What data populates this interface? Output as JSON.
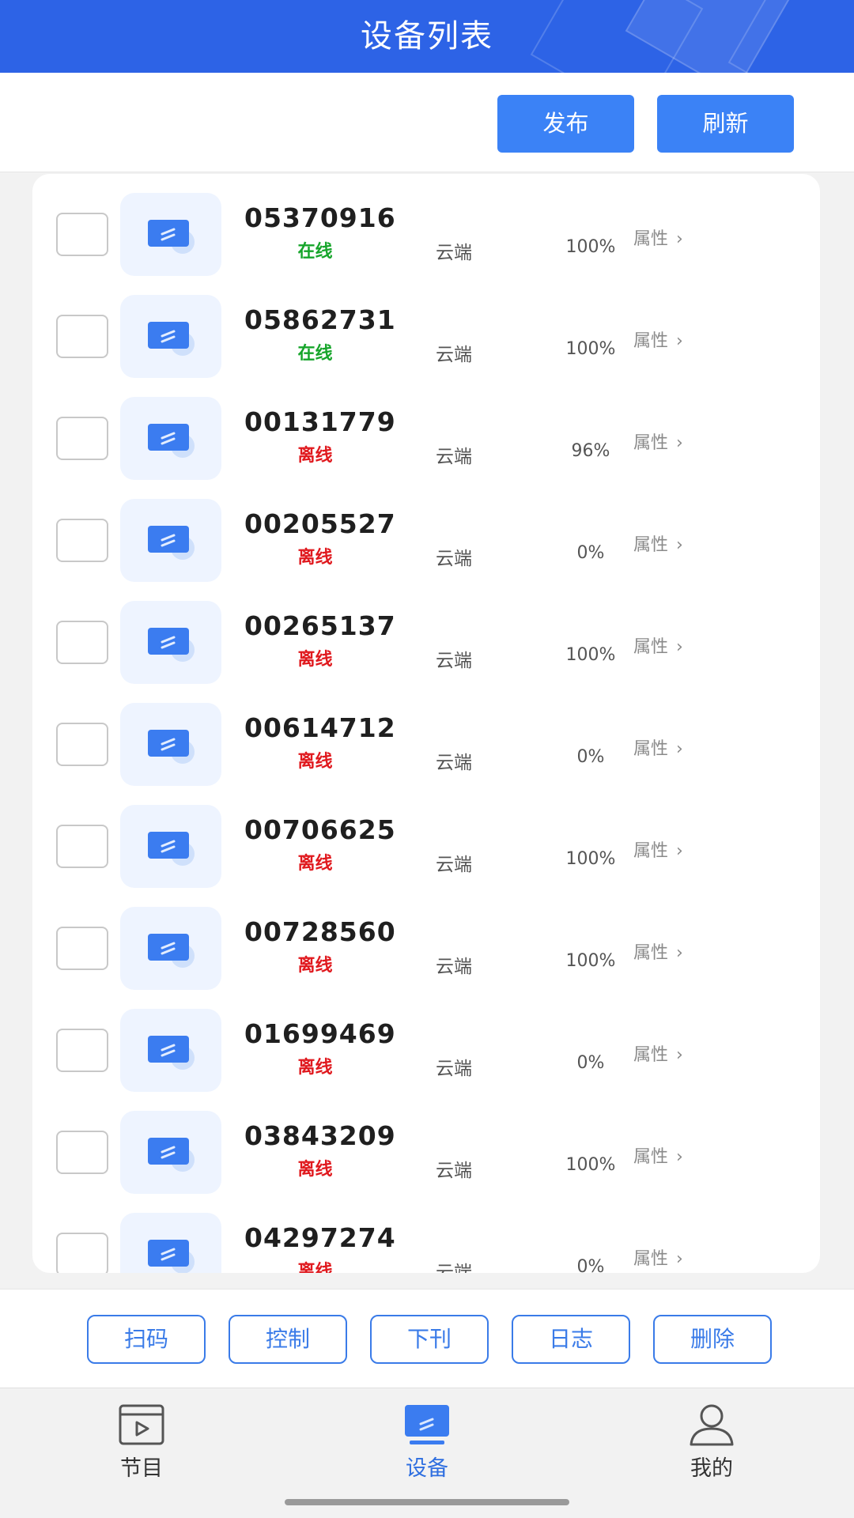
{
  "header": {
    "title": "设备列表"
  },
  "actions": {
    "publish_label": "发布",
    "refresh_label": "刷新"
  },
  "devices": [
    {
      "id": "05370916",
      "status": "在线",
      "online": true,
      "cloud": "云端",
      "percent": "100%",
      "attr": "属性"
    },
    {
      "id": "05862731",
      "status": "在线",
      "online": true,
      "cloud": "云端",
      "percent": "100%",
      "attr": "属性"
    },
    {
      "id": "00131779",
      "status": "离线",
      "online": false,
      "cloud": "云端",
      "percent": "96%",
      "attr": "属性"
    },
    {
      "id": "00205527",
      "status": "离线",
      "online": false,
      "cloud": "云端",
      "percent": "0%",
      "attr": "属性"
    },
    {
      "id": "00265137",
      "status": "离线",
      "online": false,
      "cloud": "云端",
      "percent": "100%",
      "attr": "属性"
    },
    {
      "id": "00614712",
      "status": "离线",
      "online": false,
      "cloud": "云端",
      "percent": "0%",
      "attr": "属性"
    },
    {
      "id": "00706625",
      "status": "离线",
      "online": false,
      "cloud": "云端",
      "percent": "100%",
      "attr": "属性"
    },
    {
      "id": "00728560",
      "status": "离线",
      "online": false,
      "cloud": "云端",
      "percent": "100%",
      "attr": "属性"
    },
    {
      "id": "01699469",
      "status": "离线",
      "online": false,
      "cloud": "云端",
      "percent": "0%",
      "attr": "属性"
    },
    {
      "id": "03843209",
      "status": "离线",
      "online": false,
      "cloud": "云端",
      "percent": "100%",
      "attr": "属性"
    },
    {
      "id": "04297274",
      "status": "离线",
      "online": false,
      "cloud": "云端",
      "percent": "0%",
      "attr": "属性"
    }
  ],
  "operations": {
    "scan_label": "扫码",
    "control_label": "控制",
    "unpublish_label": "下刊",
    "log_label": "日志",
    "delete_label": "删除"
  },
  "tabs": {
    "programs_label": "节目",
    "devices_label": "设备",
    "mine_label": "我的"
  },
  "colors": {
    "brand": "#2d63e6",
    "online": "#17a52b",
    "offline": "#e0191e",
    "accent": "#3a7be8"
  },
  "icons": {
    "device": "device-screen-icon",
    "programs": "program-window-icon",
    "mine": "user-icon",
    "attr_arrow": "chevron-right-icon"
  }
}
